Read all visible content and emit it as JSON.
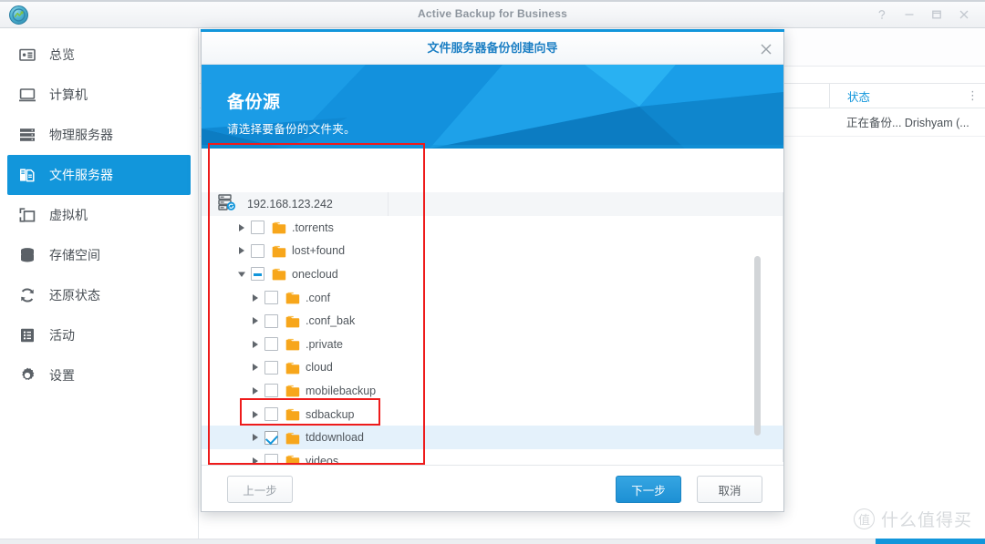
{
  "window": {
    "title": "Active Backup for Business",
    "app_icon": "active-backup-icon",
    "controls": [
      {
        "name": "help-button",
        "glyph": "?"
      },
      {
        "name": "minimize-button",
        "glyph": "–"
      },
      {
        "name": "maximize-button",
        "glyph": "□"
      },
      {
        "name": "close-button",
        "glyph": "✕"
      }
    ]
  },
  "sidebar": {
    "items": [
      {
        "label": "总览",
        "icon": "overview-icon",
        "active": false
      },
      {
        "label": "计算机",
        "icon": "computer-icon",
        "active": false
      },
      {
        "label": "物理服务器",
        "icon": "physical-server-icon",
        "active": false
      },
      {
        "label": "文件服务器",
        "icon": "file-server-icon",
        "active": true
      },
      {
        "label": "虚拟机",
        "icon": "virtual-machine-icon",
        "active": false
      },
      {
        "label": "存储空间",
        "icon": "storage-icon",
        "active": false
      },
      {
        "label": "还原状态",
        "icon": "restore-status-icon",
        "active": false
      },
      {
        "label": "活动",
        "icon": "activity-icon",
        "active": false
      },
      {
        "label": "设置",
        "icon": "settings-gear-icon",
        "active": false
      }
    ]
  },
  "background_table": {
    "column_header": "状态",
    "row_status": "正在备份... Drishyam (...",
    "menu_icon": "column-options-icon"
  },
  "dialog": {
    "title": "文件服务器备份创建向导",
    "close_icon": "close-icon",
    "banner": {
      "heading": "备份源",
      "subtitle": "请选择要备份的文件夹。"
    },
    "tree": {
      "root": {
        "label": "192.168.123.242",
        "icon": "server-sync-icon"
      },
      "nodes": [
        {
          "label": ".torrents",
          "indent": 0,
          "state": "unchecked",
          "expanded": false,
          "selected": false
        },
        {
          "label": "lost+found",
          "indent": 0,
          "state": "unchecked",
          "expanded": false,
          "selected": false
        },
        {
          "label": "onecloud",
          "indent": 0,
          "state": "partial",
          "expanded": true,
          "selected": false
        },
        {
          "label": ".conf",
          "indent": 1,
          "state": "unchecked",
          "expanded": false,
          "selected": false
        },
        {
          "label": ".conf_bak",
          "indent": 1,
          "state": "unchecked",
          "expanded": false,
          "selected": false
        },
        {
          "label": ".private",
          "indent": 1,
          "state": "unchecked",
          "expanded": false,
          "selected": false
        },
        {
          "label": "cloud",
          "indent": 1,
          "state": "unchecked",
          "expanded": false,
          "selected": false
        },
        {
          "label": "mobilebackup",
          "indent": 1,
          "state": "unchecked",
          "expanded": false,
          "selected": false
        },
        {
          "label": "sdbackup",
          "indent": 1,
          "state": "unchecked",
          "expanded": false,
          "selected": false
        },
        {
          "label": "tddownload",
          "indent": 1,
          "state": "checked",
          "expanded": false,
          "selected": true
        },
        {
          "label": "videos",
          "indent": 1,
          "state": "unchecked",
          "expanded": false,
          "selected": false
        }
      ]
    },
    "footer": {
      "prev_label": "上一步",
      "next_label": "下一步",
      "cancel_label": "取消"
    }
  },
  "watermark": {
    "badge": "值",
    "text": "什么值得买"
  },
  "colors": {
    "accent_blue": "#1296db",
    "banner_blue": "#0d95e0",
    "annotation_red": "#ee1b1b",
    "folder_orange": "#f5a623",
    "selected_row": "#e4f1fb"
  }
}
